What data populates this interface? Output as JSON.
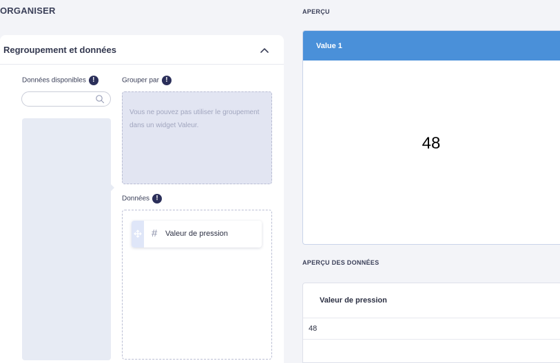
{
  "organiser": {
    "title": "ORGANISER",
    "panel_title": "Regroupement et données",
    "available_label": "Données disponibles",
    "group_by_label": "Grouper par",
    "group_by_message": "Vous ne pouvez pas utiliser le groupement dans un widget Valeur.",
    "data_label": "Données",
    "data_items": [
      {
        "label": "Valeur de pression",
        "type_icon": "#"
      }
    ],
    "search": {
      "placeholder": "",
      "value": ""
    }
  },
  "preview": {
    "title": "APERÇU",
    "widget_title": "Value 1",
    "widget_value": "48",
    "colors": {
      "header": "#4a90d9"
    }
  },
  "data_preview": {
    "title": "APERÇU DES DONNÉES",
    "columns": [
      "Valeur de pression"
    ],
    "rows": [
      [
        "48"
      ]
    ]
  }
}
